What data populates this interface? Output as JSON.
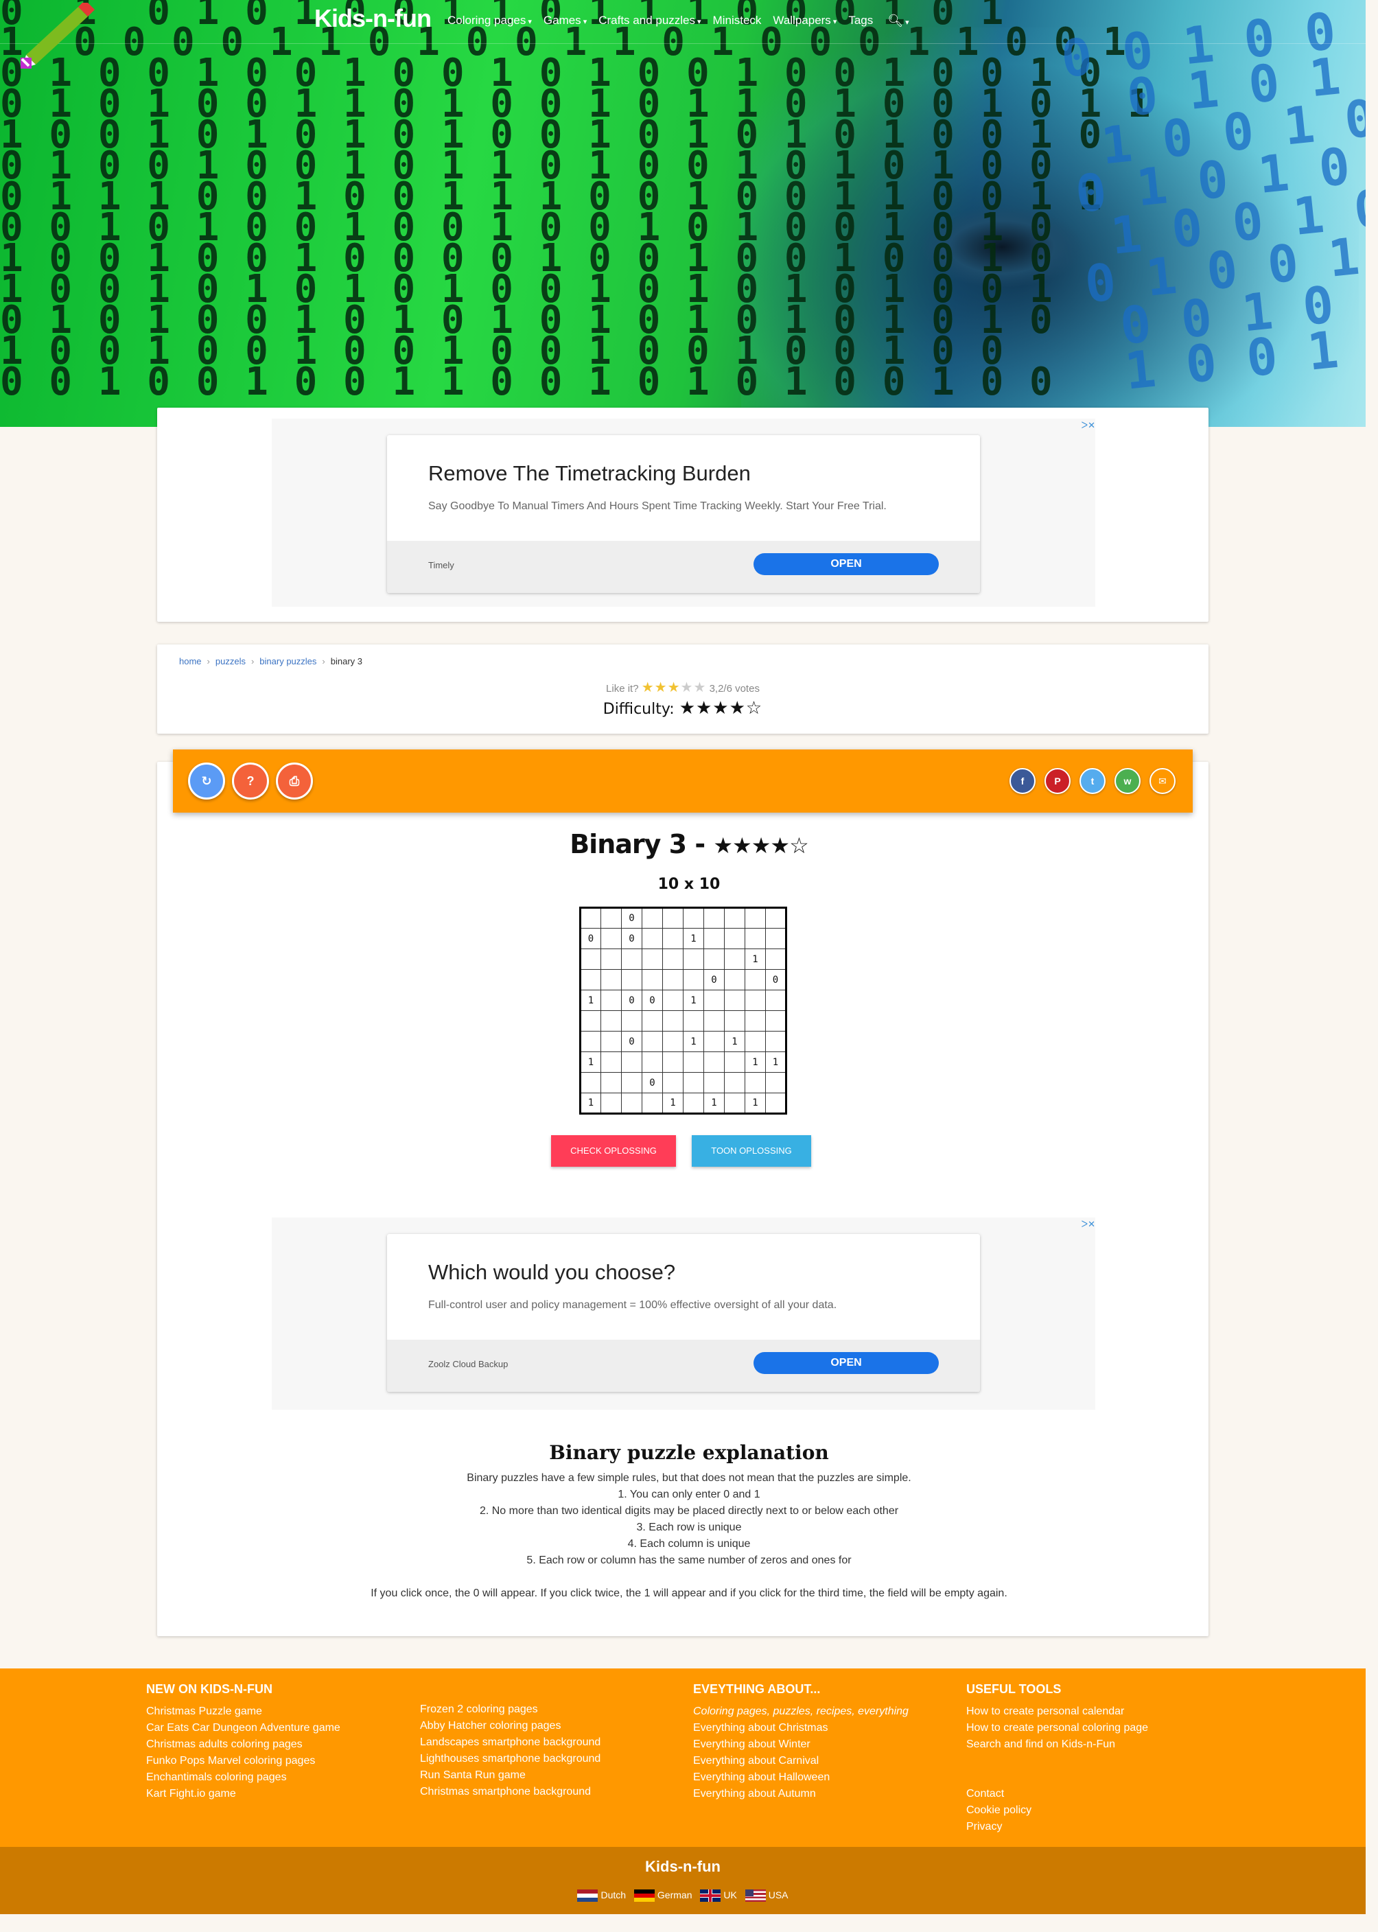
{
  "nav": {
    "brand": "Kids-n-fun",
    "menu": [
      "Coloring pages",
      "Games",
      "Crafts and puzzles",
      "Ministeck",
      "Wallpapers",
      "Tags"
    ]
  },
  "ads": [
    {
      "adchoice": "ᐳ✕",
      "title": "Remove The Timetracking Burden",
      "text": "Say Goodbye To Manual Timers And Hours Spent Time Tracking Weekly. Start Your Free Trial.",
      "source": "Timely",
      "button": "OPEN"
    },
    {
      "adchoice": "ᐳ✕",
      "title": "Which would you choose?",
      "text": "Full-control user and policy management = 100% effective oversight of all your data.",
      "source": "Zoolz Cloud Backup",
      "button": "OPEN"
    }
  ],
  "breadcrumb": [
    "home",
    "puzzels",
    "binary puzzles",
    "binary 3"
  ],
  "rating": {
    "like_label": "Like it?",
    "stars": 3,
    "max_stars": 5,
    "votes_text": "3,2/6 votes"
  },
  "difficulty": {
    "label": "Difficulty:",
    "stars": 4,
    "max_stars": 5
  },
  "toolbar": {
    "refresh_icon": "refresh-icon",
    "help_label": "?",
    "print_icon": "print-icon",
    "share": [
      {
        "name": "facebook",
        "glyph": "f",
        "color": "#3b5998"
      },
      {
        "name": "pinterest",
        "glyph": "P",
        "color": "#cb2027"
      },
      {
        "name": "twitter",
        "glyph": "t",
        "color": "#55acee"
      },
      {
        "name": "whatsapp",
        "glyph": "w",
        "color": "#4caf50"
      },
      {
        "name": "email",
        "glyph": "✉",
        "color": "#ff9800"
      }
    ]
  },
  "puzzle": {
    "title": "Binary 3 -",
    "difficulty_stars": 4,
    "size": "10 x 10",
    "grid": [
      [
        "",
        "",
        "0",
        "",
        "",
        "",
        "",
        "",
        "",
        ""
      ],
      [
        "0",
        "",
        "0",
        "",
        "",
        "1",
        "",
        "",
        "",
        ""
      ],
      [
        "",
        "",
        "",
        "",
        "",
        "",
        "",
        "",
        "1",
        ""
      ],
      [
        "",
        "",
        "",
        "",
        "",
        "",
        "0",
        "",
        "",
        "0"
      ],
      [
        "1",
        "",
        "0",
        "0",
        "",
        "1",
        "",
        "",
        "",
        ""
      ],
      [
        "",
        "",
        "",
        "",
        "",
        "",
        "",
        "",
        "",
        ""
      ],
      [
        "",
        "",
        "0",
        "",
        "",
        "1",
        "",
        "1",
        "",
        ""
      ],
      [
        "1",
        "",
        "",
        "",
        "",
        "",
        "",
        "",
        "1",
        "1"
      ],
      [
        "",
        "",
        "",
        "0",
        "",
        "",
        "",
        "",
        "",
        ""
      ],
      [
        "1",
        "",
        "",
        "",
        "1",
        "",
        "1",
        "",
        "1",
        ""
      ]
    ],
    "check_label": "CHECK OPLOSSING",
    "show_label": "TOON OPLOSSING"
  },
  "explanation": {
    "title": "Binary puzzle explanation",
    "lines": [
      "Binary puzzles have a few simple rules, but that does not mean that the puzzles are simple.",
      "1. You can only enter 0 and 1",
      "2. No more than two identical digits may be placed directly next to or below each other",
      "3. Each row is unique",
      "4. Each column is unique",
      "5. Each row or column has the same number of zeros and ones for"
    ],
    "note": "If you click once, the 0 will appear. If you click twice, the 1 will appear and if you click for the third time, the field will be empty again."
  },
  "footer": {
    "new_heading": "NEW ON KIDS-N-FUN",
    "new_col1": [
      "Christmas Puzzle game",
      "Car Eats Car Dungeon Adventure game",
      "Christmas adults coloring pages",
      "Funko Pops Marvel coloring pages",
      "Enchantimals coloring pages",
      "Kart Fight.io game"
    ],
    "new_col2": [
      "Frozen 2 coloring pages",
      "Abby Hatcher coloring pages",
      "Landscapes smartphone background",
      "Lighthouses smartphone background",
      "Run Santa Run game",
      "Christmas smartphone background"
    ],
    "everything_heading": "EVEYTHING ABOUT...",
    "everything_tagline": "Coloring pages, puzzles, recipes, everything",
    "everything_links": [
      "Everything about Christmas",
      "Everything about Winter",
      "Everything about Carnival",
      "Everything about Halloween",
      "Everything about Autumn"
    ],
    "tools_heading": "USEFUL TOOLS",
    "tools_links": [
      "How to create personal calendar",
      "How to create personal coloring page",
      "Search and find on Kids-n-Fun"
    ],
    "misc_links": [
      "Contact",
      "Cookie policy",
      "Privacy"
    ],
    "brand": "Kids-n-fun",
    "languages": [
      "Dutch",
      "German",
      "UK",
      "USA"
    ]
  }
}
